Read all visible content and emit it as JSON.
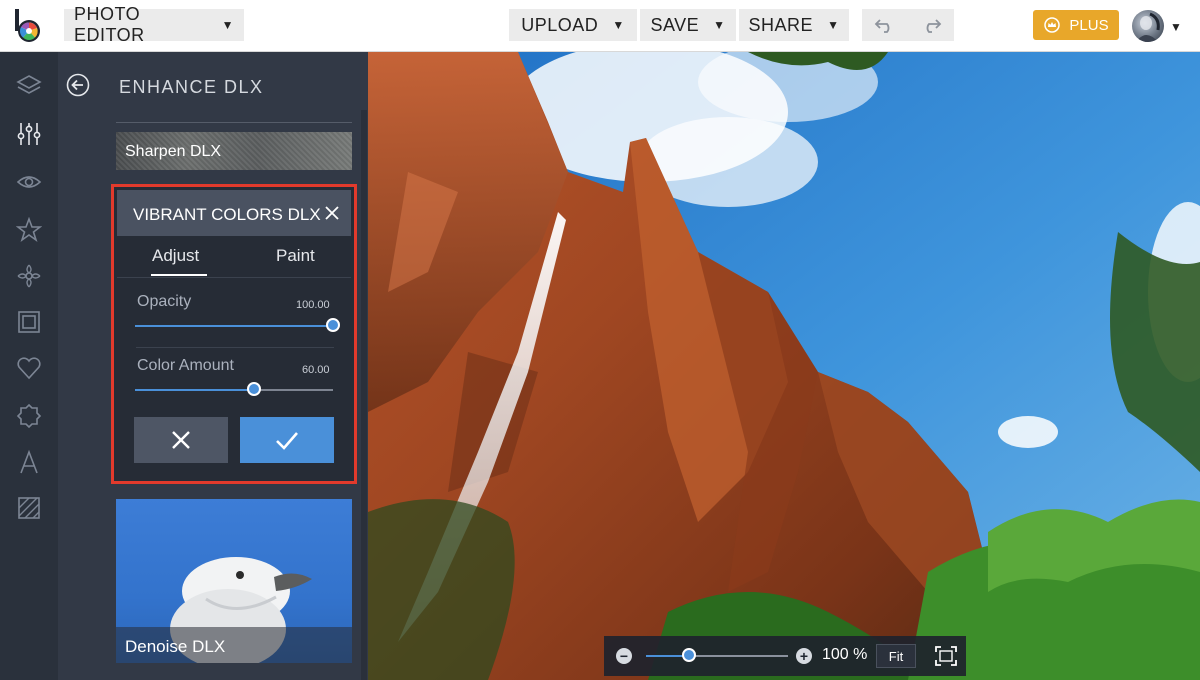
{
  "topbar": {
    "app_menu_label": "PHOTO EDITOR",
    "upload_label": "UPLOAD",
    "save_label": "SAVE",
    "share_label": "SHARE",
    "plus_label": "PLUS",
    "icons": [
      "logo-icon",
      "undo-icon",
      "redo-icon",
      "crown-icon",
      "avatar"
    ]
  },
  "rail": {
    "icons": [
      "layers-icon",
      "sliders-icon",
      "eye-icon",
      "star-icon",
      "flower-icon",
      "frame-icon",
      "heart-icon",
      "sticker-icon",
      "text-icon",
      "texture-icon"
    ]
  },
  "panel": {
    "title": "ENHANCE DLX",
    "effects": [
      {
        "label": "Sharpen DLX"
      },
      {
        "label": "Denoise DLX"
      }
    ],
    "active_effect": {
      "title": "VIBRANT COLORS DLX",
      "tabs": [
        "Adjust",
        "Paint"
      ],
      "selected_tab": "Adjust",
      "sliders": [
        {
          "label": "Opacity",
          "value": "100.00",
          "fraction": 1.0
        },
        {
          "label": "Color Amount",
          "value": "60.00",
          "fraction": 0.6
        }
      ]
    }
  },
  "zoom": {
    "value": "100 %",
    "fit_label": "Fit",
    "fraction": 0.3
  },
  "colors": {
    "accent": "#4a90d9",
    "plus": "#e8a72a",
    "highlight": "#e23a2c",
    "panel": "#323946",
    "rail": "#2a313c"
  }
}
